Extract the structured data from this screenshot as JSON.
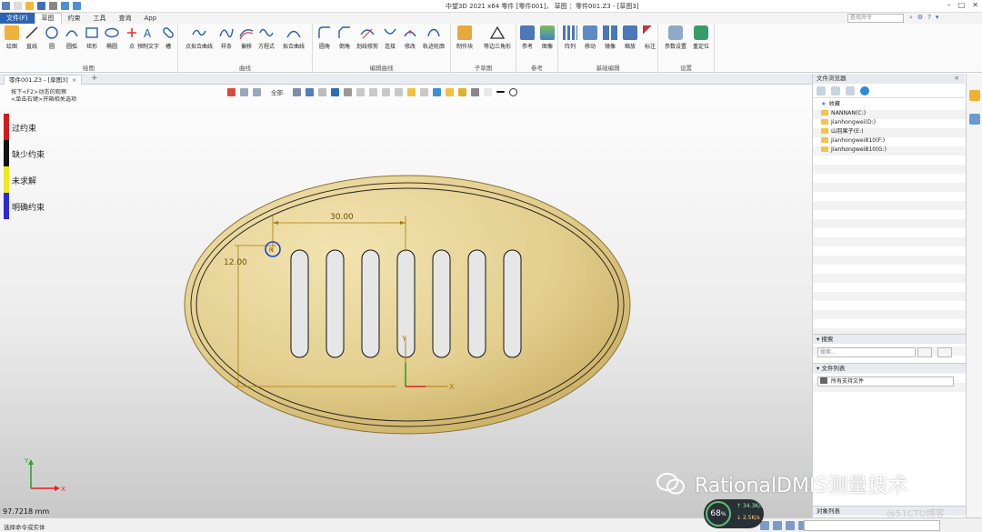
{
  "app": {
    "title": "中望3D 2021 x64      零件 [零件001]， 草图 ：零件001.Z3 - [草图3]"
  },
  "menu": {
    "file": "文件(F)",
    "items": [
      "草图",
      "约束",
      "工具",
      "查询",
      "App"
    ],
    "active_index": 0,
    "search_placeholder": "查找命令"
  },
  "ribbon": {
    "groups": [
      {
        "label": "绘图",
        "buttons": [
          "绘图",
          "直线",
          "圆",
          "圆弧",
          "矩形",
          "椭圆",
          "点",
          "预制文字",
          "槽"
        ]
      },
      {
        "label": "曲线",
        "buttons": [
          "点拟合曲线",
          "样条",
          "偏移",
          "方程式",
          "拟合曲线"
        ]
      },
      {
        "label": "编辑曲线",
        "buttons": [
          "圆角",
          "倒角",
          "划线修剪",
          "连接",
          "修改",
          "轨迹轮廓"
        ]
      },
      {
        "label": "子草图",
        "buttons": [
          "制作块",
          "等边三角形"
        ]
      },
      {
        "label": "参考",
        "buttons": [
          "参考",
          "图像"
        ]
      },
      {
        "label": "基础编辑",
        "buttons": [
          "阵列",
          "移动",
          "镜像",
          "缩放",
          "标注"
        ]
      },
      {
        "label": "设置",
        "buttons": [
          "参数设置",
          "重定位"
        ]
      }
    ]
  },
  "document_tab": {
    "label": "零件001.Z3 - [草图3]",
    "close": "×",
    "add": "+"
  },
  "viewport": {
    "hint_line1": "按下<F2>动态的观察",
    "hint_line2": "<单击右键>开箱相关选项",
    "toolbar_label": "全部",
    "dimension_horizontal": "30.00",
    "dimension_vertical": "12.00",
    "axis_x": "X",
    "axis_y": "Y",
    "cursor_readout": "97.7218 mm",
    "triad_x": "X",
    "triad_y": "Y"
  },
  "constraint_legend": [
    {
      "label": "过约束",
      "color": "#d11b1b"
    },
    {
      "label": "缺少约束",
      "color": "#111111"
    },
    {
      "label": "未求解",
      "color": "#f2e51f"
    },
    {
      "label": "明确约束",
      "color": "#2a2ad6"
    }
  ],
  "file_browser": {
    "title": "文件浏览器",
    "tree": [
      {
        "label": "收藏",
        "type": "star"
      },
      {
        "label": "NANNAN(C:)",
        "type": "folder"
      },
      {
        "label": "Jianhongwei(D:)",
        "type": "folder"
      },
      {
        "label": "山羽果子(E:)",
        "type": "folder"
      },
      {
        "label": "Jianhongwei810(F:)",
        "type": "folder"
      },
      {
        "label": "Jianhongwei810(G:)",
        "type": "folder"
      }
    ],
    "search_section": "搜索",
    "search_placeholder": "搜索...",
    "filelist_section": "文件列表",
    "filter_value": "所有支持文件",
    "object_list": "对象列表"
  },
  "statusbar": {
    "message": "选择命令或实体"
  },
  "perf_widget": {
    "percent": "68",
    "percent_unit": "%",
    "upload": "34.3",
    "upload_unit": "K/s",
    "download": "2.5",
    "download_unit": "K/s"
  },
  "watermark": {
    "text": "RationalDMIS测量技术",
    "source": "@51CTO博客"
  },
  "colors": {
    "part_face": "#e3cf8f",
    "part_edge": "#8a7436",
    "dimension": "#b07a00",
    "accent": "#2b64b7"
  }
}
